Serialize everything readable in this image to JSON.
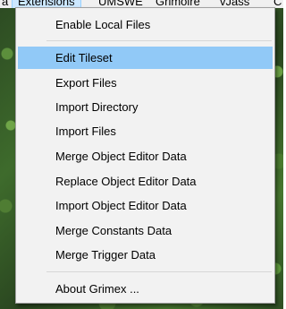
{
  "menubar": {
    "items": [
      {
        "label": "a"
      },
      {
        "label": "Extensions"
      },
      {
        "label": "UMSWE"
      },
      {
        "label": "Grimoire"
      },
      {
        "label": "vJass"
      },
      {
        "label": "C"
      }
    ]
  },
  "menu": {
    "items": [
      {
        "label": "Enable Local Files"
      },
      {
        "label": "Edit Tileset"
      },
      {
        "label": "Export Files"
      },
      {
        "label": "Import Directory"
      },
      {
        "label": "Import Files"
      },
      {
        "label": "Merge Object Editor Data"
      },
      {
        "label": "Replace Object Editor Data"
      },
      {
        "label": "Import Object Editor Data"
      },
      {
        "label": "Merge Constants Data"
      },
      {
        "label": "Merge Trigger Data"
      },
      {
        "label": "About Grimex ..."
      }
    ],
    "highlighted_item": "Edit Tileset"
  },
  "colors": {
    "menu_background": "#f2f2f2",
    "highlight": "#91c9f7",
    "menubar_active": "#cce8ff"
  }
}
